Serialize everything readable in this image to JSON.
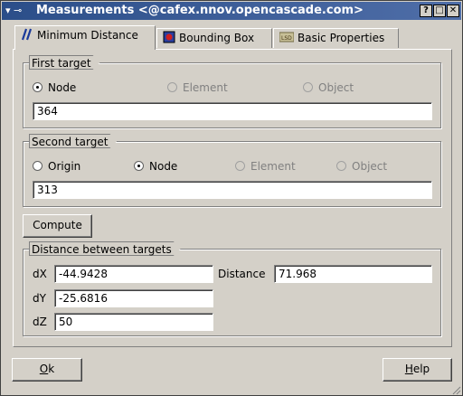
{
  "window": {
    "sysmenu": "▾ ⊸",
    "title": "Measurements <@cafex.nnov.opencascade.com>",
    "buttons": {
      "help": "?",
      "maximize": "□",
      "close": "✕"
    }
  },
  "tabs": [
    {
      "label": "Minimum Distance",
      "icon": "min-distance-icon",
      "active": true
    },
    {
      "label": "Bounding Box",
      "icon": "bounding-box-icon",
      "active": false
    },
    {
      "label": "Basic Properties",
      "icon": "basic-properties-icon",
      "active": false
    }
  ],
  "first_target": {
    "legend": "First target",
    "options": [
      {
        "label": "Node",
        "checked": true,
        "enabled": true
      },
      {
        "label": "Element",
        "checked": false,
        "enabled": false
      },
      {
        "label": "Object",
        "checked": false,
        "enabled": false
      }
    ],
    "value": "364"
  },
  "second_target": {
    "legend": "Second target",
    "options": [
      {
        "label": "Origin",
        "checked": false,
        "enabled": true
      },
      {
        "label": "Node",
        "checked": true,
        "enabled": true
      },
      {
        "label": "Element",
        "checked": false,
        "enabled": false
      },
      {
        "label": "Object",
        "checked": false,
        "enabled": false
      }
    ],
    "value": "313"
  },
  "compute_label": "Compute",
  "distance": {
    "legend": "Distance between targets",
    "dx_label": "dX",
    "dx": "-44.9428",
    "dy_label": "dY",
    "dy": "-25.6816",
    "dz_label": "dZ",
    "dz": "50",
    "distance_label": "Distance",
    "distance": "71.968"
  },
  "footer": {
    "ok_first": "O",
    "ok_rest": "k",
    "help_first": "H",
    "help_rest": "elp"
  },
  "colors": {
    "titlebar": "#2b4e89",
    "dialog_bg": "#d4d0c8"
  }
}
